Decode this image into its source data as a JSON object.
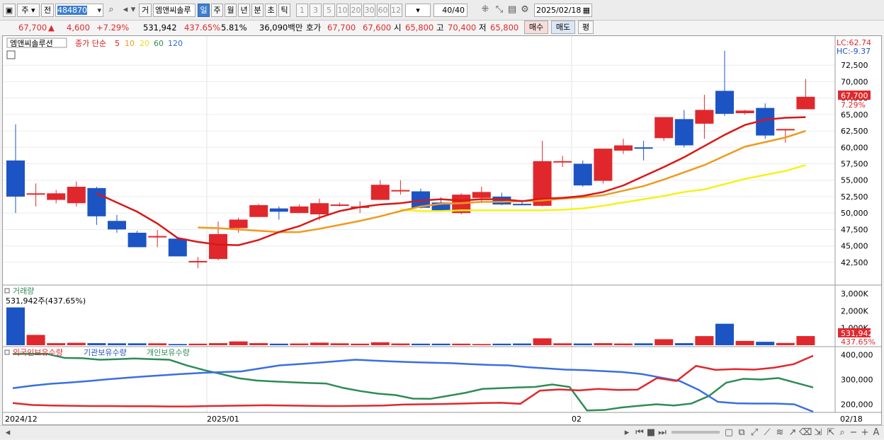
{
  "toolbar": {
    "market": "주",
    "prev_label": "전",
    "code": "484870",
    "name": "엠앤씨솔루",
    "reg_label": "거",
    "periods": [
      "일",
      "주",
      "월",
      "년",
      "분",
      "초",
      "틱"
    ],
    "selected_period": "일",
    "minutes": [
      "1",
      "3",
      "5",
      "10",
      "20",
      "30",
      "60",
      "120"
    ],
    "count": "40/40",
    "date": "2025/02/18"
  },
  "quote": {
    "price": "67,700",
    "change_arrow": "▲",
    "change": "4,600",
    "change_pct": "+7.29%",
    "volume": "531,942",
    "volume_ratio": "437.65%",
    "turnover": "5.81%",
    "amount": "36,090백만",
    "bid_label": "호가",
    "bid1": "67,700",
    "bid2": "67,600",
    "open_label": "시",
    "open": "65,800",
    "high_label": "고",
    "high": "70,400",
    "low_label": "저",
    "low": "65,800",
    "buy_button": "매수",
    "sell_button": "매도",
    "avg_button": "평"
  },
  "price_panel": {
    "legend_name": "엠앤씨솔루션",
    "legend_ma": "종가 단순",
    "ma_periods": [
      "5",
      "10",
      "20",
      "60",
      "120"
    ],
    "lc": "LC:62.74",
    "hc": "HC:-9.37",
    "price_tag": "67,700",
    "pct_tag": "7.29%"
  },
  "volume_panel": {
    "label": "거래량",
    "current": "531,942주(437.65%)",
    "tag_volume": "531,942",
    "tag_pct": "437.65%",
    "axis_ticks": [
      "3,000K",
      "2,000K",
      "1,000K"
    ]
  },
  "holding_panel": {
    "series_labels": [
      "외국인보유수량",
      "기관보유수량",
      "개인보유수량"
    ],
    "axis_ticks": [
      "400,000",
      "300,000",
      "200,000"
    ]
  },
  "x_axis": {
    "labels": [
      "2024/12",
      "2025/01",
      "02",
      "02/18"
    ]
  },
  "colors": {
    "up": "#e0282c",
    "down": "#1c54c4",
    "ma5": "#d81818",
    "ma10": "#ef9a1e",
    "ma20": "#f4f21a",
    "foreign": "#e0282c",
    "inst": "#3b6fe0",
    "retail": "#2e8b57"
  },
  "chart_data": {
    "type": "candlestick",
    "dates": [
      "2024-12-24",
      "2024-12-26",
      "2024-12-27",
      "2024-12-30",
      "2024-12-31",
      "2025-01-02",
      "2025-01-03",
      "2025-01-06",
      "2025-01-07",
      "2025-01-08",
      "2025-01-09",
      "2025-01-10",
      "2025-01-13",
      "2025-01-14",
      "2025-01-15",
      "2025-01-16",
      "2025-01-17",
      "2025-01-20",
      "2025-01-21",
      "2025-01-22",
      "2025-01-23",
      "2025-01-24",
      "2025-01-31",
      "2025-02-03",
      "2025-02-04",
      "2025-02-05",
      "2025-02-06",
      "2025-02-07",
      "2025-02-10",
      "2025-02-11",
      "2025-02-12",
      "2025-02-13",
      "2025-02-14",
      "2025-02-17",
      "2025-02-18"
    ],
    "ohlc": [
      [
        58000,
        63500,
        50000,
        52500
      ],
      [
        53000,
        54500,
        51000,
        53000
      ],
      [
        52000,
        53500,
        51500,
        53000
      ],
      [
        51500,
        54800,
        51000,
        54000
      ],
      [
        53800,
        54000,
        48200,
        49500
      ],
      [
        48800,
        49700,
        47000,
        47500
      ],
      [
        47000,
        47300,
        44800,
        44800
      ],
      [
        46500,
        47400,
        44800,
        46500
      ],
      [
        46100,
        46200,
        43400,
        43400
      ],
      [
        42500,
        43300,
        41600,
        42700
      ],
      [
        43000,
        48700,
        42800,
        46800
      ],
      [
        47700,
        49300,
        47000,
        49000
      ],
      [
        49400,
        51400,
        49400,
        51200
      ],
      [
        50700,
        51000,
        49000,
        50200
      ],
      [
        50000,
        51300,
        50000,
        51000
      ],
      [
        49800,
        52200,
        48900,
        51500
      ],
      [
        51300,
        51600,
        51000,
        51300
      ],
      [
        51000,
        51800,
        50000,
        51000
      ],
      [
        52000,
        55000,
        52000,
        54300
      ],
      [
        53500,
        55000,
        52800,
        53500
      ],
      [
        53300,
        53700,
        50700,
        50800
      ],
      [
        51600,
        52400,
        50600,
        50300
      ],
      [
        50000,
        53000,
        49800,
        52800
      ],
      [
        52300,
        54000,
        51500,
        53200
      ],
      [
        52500,
        53100,
        51200,
        51300
      ],
      [
        51400,
        52000,
        51200,
        51300
      ],
      [
        51100,
        61000,
        51000,
        57900
      ],
      [
        57900,
        58700,
        57000,
        57900
      ],
      [
        57500,
        58000,
        54000,
        54200
      ],
      [
        54900,
        59800,
        54500,
        59800
      ],
      [
        59500,
        61300,
        59000,
        60300
      ],
      [
        60000,
        61000,
        58000,
        59800
      ],
      [
        61400,
        64600,
        61000,
        64600
      ],
      [
        64300,
        65700,
        60000,
        60300
      ],
      [
        63600,
        68000,
        61300,
        65700
      ],
      [
        68600,
        74700,
        64800,
        65100
      ],
      [
        65200,
        65700,
        65000,
        65600
      ],
      [
        66000,
        66700,
        61300,
        61800
      ],
      [
        62700,
        62800,
        60700,
        62800
      ],
      [
        65800,
        70400,
        65800,
        67700
      ]
    ],
    "ma5": [
      null,
      null,
      null,
      null,
      53000,
      51600,
      50200,
      48400,
      46200,
      45600,
      45200,
      45100,
      45900,
      47100,
      48000,
      49300,
      50300,
      50900,
      51300,
      51500,
      51900,
      52100,
      51900,
      52100,
      52100,
      51800,
      52200,
      52300,
      52600,
      53200,
      54200,
      55600,
      57000,
      58500,
      60200,
      61900,
      63400,
      64200,
      64500,
      64600
    ],
    "ma10": [
      null,
      null,
      null,
      null,
      null,
      null,
      null,
      null,
      null,
      47800,
      47700,
      47500,
      47300,
      47100,
      47100,
      47600,
      48200,
      48800,
      49500,
      50300,
      51000,
      51400,
      51500,
      51700,
      51700,
      51800,
      51900,
      52200,
      52400,
      52700,
      53400,
      54100,
      55100,
      56200,
      57300,
      58700,
      60100,
      60800,
      61500,
      62500
    ],
    "ma20": [
      null,
      null,
      null,
      null,
      null,
      null,
      null,
      null,
      null,
      null,
      null,
      null,
      null,
      null,
      null,
      null,
      null,
      null,
      null,
      50500,
      50300,
      50300,
      50400,
      50400,
      50400,
      50400,
      50400,
      50500,
      50700,
      51100,
      51600,
      52100,
      52600,
      53200,
      53600,
      54400,
      55200,
      55800,
      56400,
      57300
    ],
    "volume_k": [
      2200,
      600,
      120,
      140,
      120,
      110,
      110,
      110,
      70,
      90,
      120,
      220,
      120,
      90,
      100,
      150,
      110,
      90,
      170,
      100,
      90,
      90,
      90,
      70,
      90,
      100,
      400,
      110,
      100,
      120,
      100,
      110,
      350,
      120,
      530,
      1250,
      250,
      200,
      130,
      532
    ],
    "foreign": [
      205,
      197,
      195,
      194,
      193,
      193,
      192,
      192,
      191,
      191,
      193,
      194,
      195,
      196,
      195,
      194,
      193,
      193,
      194,
      195,
      199,
      200,
      201,
      203,
      205,
      206,
      202,
      255,
      260,
      256,
      262,
      258,
      259,
      306,
      294,
      355,
      339,
      342,
      340,
      348,
      362,
      396
    ],
    "inst": [
      265,
      275,
      283,
      288,
      294,
      301,
      307,
      313,
      318,
      323,
      327,
      330,
      333,
      345,
      357,
      362,
      368,
      374,
      380,
      376,
      373,
      370,
      368,
      366,
      362,
      359,
      357,
      350,
      345,
      340,
      338,
      334,
      330,
      322,
      308,
      294,
      258,
      210,
      204,
      203,
      203,
      200,
      170
    ],
    "retail": [
      403,
      404,
      403,
      387,
      386,
      380,
      382,
      385,
      382,
      380,
      357,
      338,
      322,
      305,
      296,
      292,
      289,
      286,
      284,
      266,
      253,
      243,
      237,
      223,
      222,
      234,
      246,
      262,
      265,
      268,
      270,
      280,
      270,
      175,
      177,
      187,
      194,
      200,
      195,
      203,
      233,
      287,
      303,
      300,
      306,
      287,
      268
    ]
  }
}
